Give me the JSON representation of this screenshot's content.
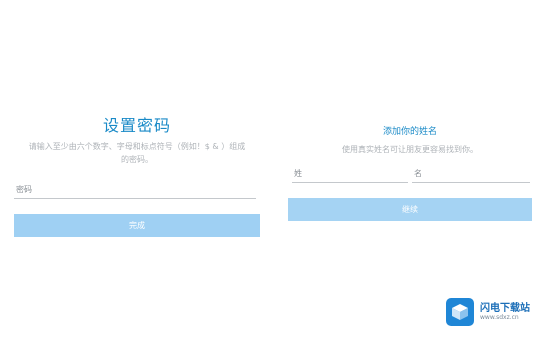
{
  "set_password": {
    "title": "设置密码",
    "description": "请输入至少由六个数字、字母和标点符号（例如！$ & ）组成的密码。",
    "password_label": "密码",
    "submit_label": "完成"
  },
  "add_name": {
    "title": "添加你的姓名",
    "description": "使用真实姓名可让朋友更容易找到你。",
    "surname_label": "姓",
    "given_name_label": "名",
    "submit_label": "继续"
  },
  "watermark": {
    "title": "闪电下载站",
    "url": "www.sdxz.cn"
  },
  "colors": {
    "title_blue": "#1a8ac7",
    "button_blue": "#9fd0f3",
    "watermark_blue": "#1f86d6"
  }
}
